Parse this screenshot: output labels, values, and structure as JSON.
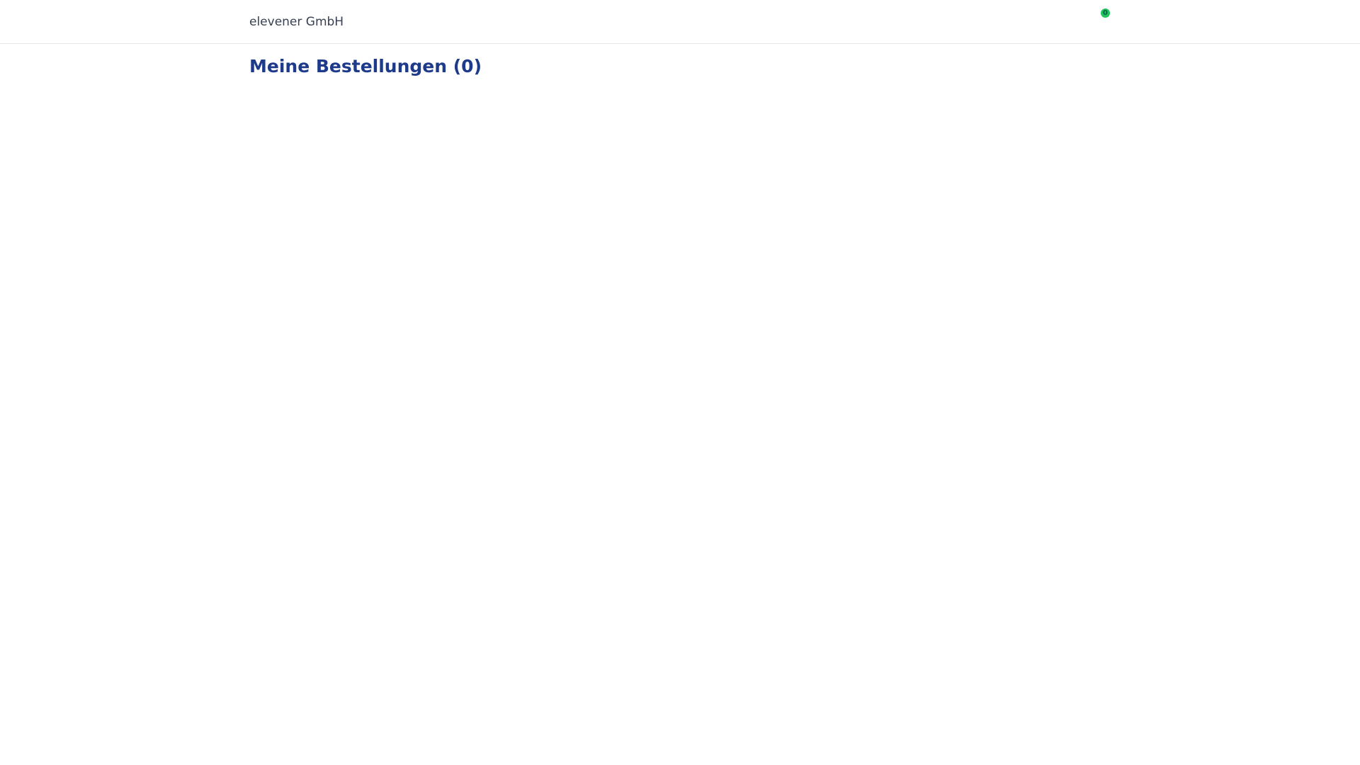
{
  "header": {
    "brand": "elevener GmbH",
    "cart_count": "0",
    "badge_color": "#22c55e"
  },
  "main": {
    "title": "Meine Bestellungen (0)",
    "title_color": "#1e3a8a"
  }
}
